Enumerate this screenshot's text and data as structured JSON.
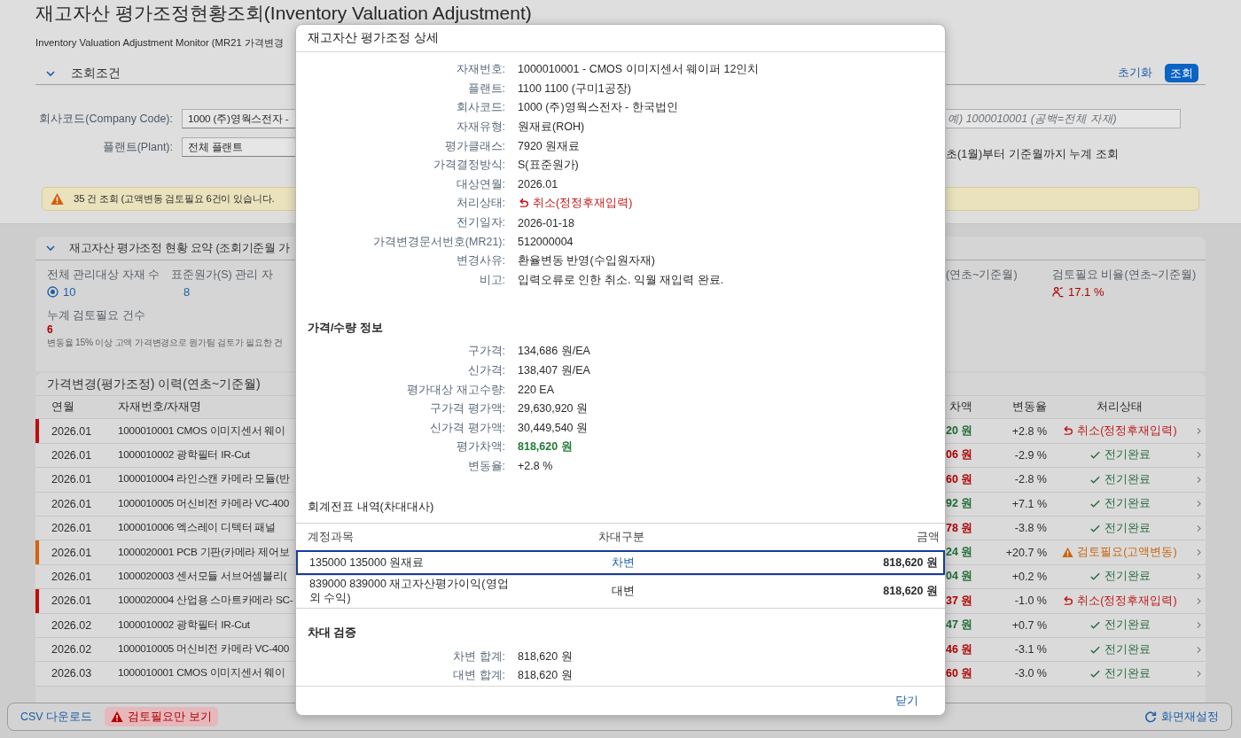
{
  "page": {
    "title": "재고자산 평가조정현황조회(Inventory Valuation Adjustment)",
    "subtitle": "Inventory Valuation Adjustment Monitor (MR21 가격변경"
  },
  "filter": {
    "title": "조회조건",
    "expanded": true,
    "reset_label": "초기화",
    "search_label": "조회",
    "fields": [
      {
        "label": "회사코드(Company Code):",
        "value": "1000 (주)영웍스전자 -"
      },
      {
        "label": "플랜트(Plant):",
        "value": "전체 플랜트"
      }
    ],
    "material_field": {
      "placeholder": "예) 1000010001 (공백=전체 자재)"
    },
    "note": "초(1월)부터 기준월까지 누계 조회"
  },
  "message": {
    "kind": "warning",
    "text": "35 건 조회 (고액변동 검토필요 6건이 있습니다."
  },
  "summary": {
    "title": "재고자산 평가조정 현황 요약 (조회기준월 가",
    "expanded": true,
    "kpis_left": [
      {
        "label": "전체 관리대상 자재 수",
        "value": "10",
        "kind": "total"
      },
      {
        "label": "표준원가(S) 관리 자",
        "value": "8",
        "kind": "plain"
      }
    ],
    "kpis_right": [
      {
        "label": "(연초~기준월)",
        "kind": "plain"
      },
      {
        "label": "검토필요 비율(연초~기준월)",
        "value": "17.1 %",
        "kind": "ratio"
      }
    ],
    "review": {
      "label": "누계 검토필요 건수",
      "value": "6",
      "note": "변동율 15% 이상 고액 가격변경으로 원가팀 검토가 필요한 건"
    }
  },
  "history": {
    "title": "가격변경(평가조정) 이력(연초~기준월)",
    "columns": [
      "연월",
      "자재번호/자재명",
      "차액",
      "변동율",
      "처리상태"
    ],
    "rows": [
      {
        "month": "2026.01",
        "material": "1000010001 CMOS 이미지센서 웨이",
        "amount": {
          "text": "20 원",
          "kind": "gain"
        },
        "rate": "+2.8 %",
        "status": {
          "kind": "cancel",
          "text": "취소(정정후재입력)"
        },
        "color": "#c40b0b"
      },
      {
        "month": "2026.01",
        "material": "1000010002 광학필터 IR-Cut",
        "amount": {
          "text": "06 원",
          "kind": "loss"
        },
        "rate": "-2.9 %",
        "status": {
          "kind": "posted",
          "text": "전기완료"
        }
      },
      {
        "month": "2026.01",
        "material": "1000010004 라인스캔 카메라 모듈(반",
        "amount": {
          "text": "60 원",
          "kind": "loss"
        },
        "rate": "-2.8 %",
        "status": {
          "kind": "posted",
          "text": "전기완료"
        }
      },
      {
        "month": "2026.01",
        "material": "1000010005 머신비전 카메라 VC-400",
        "amount": {
          "text": "92 원",
          "kind": "gain"
        },
        "rate": "+7.1 %",
        "status": {
          "kind": "posted",
          "text": "전기완료"
        }
      },
      {
        "month": "2026.01",
        "material": "1000010006 엑스레이 디텍터 패널",
        "amount": {
          "text": "78 원",
          "kind": "loss"
        },
        "rate": "-3.8 %",
        "status": {
          "kind": "posted",
          "text": "전기완료"
        }
      },
      {
        "month": "2026.01",
        "material": "1000020001 PCB 기판(카메라 제어보",
        "amount": {
          "text": "24 원",
          "kind": "gain"
        },
        "rate": "+20.7 %",
        "status": {
          "kind": "review",
          "text": "검토필요(고액변동)"
        },
        "color": "#d9600a"
      },
      {
        "month": "2026.01",
        "material": "1000020003 센서모듈 서브어셈블리(",
        "amount": {
          "text": "04 원",
          "kind": "gain"
        },
        "rate": "+0.2 %",
        "status": {
          "kind": "posted",
          "text": "전기완료"
        }
      },
      {
        "month": "2026.01",
        "material": "1000020004 산업용 스마트카메라 SC-",
        "amount": {
          "text": "37 원",
          "kind": "loss"
        },
        "rate": "-1.0 %",
        "status": {
          "kind": "cancel",
          "text": "취소(정정후재입력)"
        },
        "color": "#c40b0b"
      },
      {
        "month": "2026.02",
        "material": "1000010002 광학필터 IR-Cut",
        "amount": {
          "text": "47 원",
          "kind": "gain"
        },
        "rate": "+0.7 %",
        "status": {
          "kind": "posted",
          "text": "전기완료"
        }
      },
      {
        "month": "2026.02",
        "material": "1000010005 머신비전 카메라 VC-400",
        "amount": {
          "text": "46 원",
          "kind": "loss"
        },
        "rate": "-3.1 %",
        "status": {
          "kind": "posted",
          "text": "전기완료"
        }
      },
      {
        "month": "2026.03",
        "material": "1000010001 CMOS 이미지센서 웨이",
        "amount": {
          "text": "60 원",
          "kind": "loss"
        },
        "rate": "-3.0 %",
        "status": {
          "kind": "posted",
          "text": "전기완료"
        }
      }
    ]
  },
  "footer": {
    "csv_label": "CSV 다운로드",
    "review_only_label": "검토필요만 보기",
    "reset_label": "화면재설정"
  },
  "dialog": {
    "title": "재고자산 평가조정 상세",
    "details": [
      {
        "label": "자재번호:",
        "value": "1000010001 - CMOS 이미지센서 웨이퍼 12인치",
        "kind": "text"
      },
      {
        "label": "플랜트:",
        "value": "1100 1100 (구미1공장)",
        "kind": "text"
      },
      {
        "label": "회사코드:",
        "value": "1000 (주)영웍스전자 - 한국법인",
        "kind": "text"
      },
      {
        "label": "자재유형:",
        "value": "원재료(ROH)",
        "kind": "text"
      },
      {
        "label": "평가클래스:",
        "value": "7920 원재료",
        "kind": "text"
      },
      {
        "label": "가격결정방식:",
        "value": "S(표준원가)",
        "kind": "text"
      },
      {
        "label": "대상연월:",
        "value": "2026.01",
        "kind": "text"
      },
      {
        "label": "처리상태:",
        "value": "취소(정정후재입력)",
        "kind": "cancel"
      },
      {
        "label": "전기일자:",
        "value": "2026-01-18",
        "kind": "text"
      },
      {
        "label": "가격변경문서번호(MR21):",
        "value": "512000004",
        "kind": "text"
      },
      {
        "label": "변경사유:",
        "value": "환율변동 반영(수입원자재)",
        "kind": "text"
      },
      {
        "label": "비고:",
        "value": "입력오류로 인한 취소. 익월 재입력 완료.",
        "kind": "text"
      }
    ],
    "price": {
      "title": "가격/수량 정보",
      "rows": [
        {
          "label": "구가격:",
          "value": "134,686 원/EA",
          "kind": "text"
        },
        {
          "label": "신가격:",
          "value": "138,407 원/EA",
          "kind": "text"
        },
        {
          "label": "평가대상 재고수량:",
          "value": "220 EA",
          "kind": "text"
        },
        {
          "label": "구가격 평가액:",
          "value": "29,630,920 원",
          "kind": "text"
        },
        {
          "label": "신가격 평가액:",
          "value": "30,449,540 원",
          "kind": "text"
        },
        {
          "label": "평가차액:",
          "value": "818,620 원",
          "kind": "gain"
        },
        {
          "label": "변동율:",
          "value": "+2.8 %",
          "kind": "text"
        }
      ]
    },
    "journal": {
      "title": "회계전표 내역(차대대사)",
      "columns": [
        "계정과목",
        "차대구분",
        "금액"
      ],
      "rows": [
        {
          "account": "135000 135000 원재료",
          "side": {
            "text": "차변",
            "kind": "debit"
          },
          "amount": "818,620 원",
          "selected": true
        },
        {
          "account": "839000 839000 재고자산평가이익(영업외 수익)",
          "side": {
            "text": "대변",
            "kind": "credit"
          },
          "amount": "818,620 원",
          "selected": false
        }
      ]
    },
    "balance": {
      "title": "차대 검증",
      "rows": [
        {
          "label": "차변 합계:",
          "value": "818,620 원",
          "kind": "text"
        },
        {
          "label": "대변 합계:",
          "value": "818,620 원",
          "kind": "text"
        }
      ]
    },
    "close_label": "닫기"
  }
}
